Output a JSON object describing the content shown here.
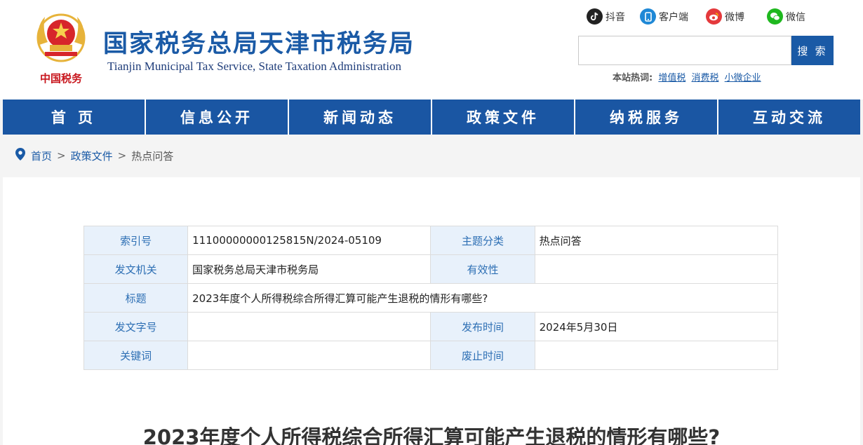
{
  "header": {
    "site_title": "国家税务总局天津市税务局",
    "site_subtitle": "Tianjin Municipal Tax Service, State Taxation Administration",
    "logo_text": "中国税务"
  },
  "social": [
    {
      "label": "抖音",
      "icon": "douyin-icon"
    },
    {
      "label": "客户端",
      "icon": "mobile-client-icon"
    },
    {
      "label": "微博",
      "icon": "weibo-icon"
    },
    {
      "label": "微信",
      "icon": "wechat-icon"
    }
  ],
  "search": {
    "value": "",
    "placeholder": "",
    "button_label": "搜 索",
    "hot_label": "本站热词:",
    "hot_words": [
      "增值税",
      "消费税",
      "小微企业"
    ]
  },
  "nav": [
    "首 页",
    "信息公开",
    "新闻动态",
    "政策文件",
    "纳税服务",
    "互动交流"
  ],
  "breadcrumb": {
    "items": [
      "首页",
      "政策文件",
      "热点问答"
    ],
    "separator": ">"
  },
  "meta": {
    "index_label": "索引号",
    "index_value": "11100000000125815N/2024-05109",
    "topic_label": "主题分类",
    "topic_value": "热点问答",
    "issuer_label": "发文机关",
    "issuer_value": "国家税务总局天津市税务局",
    "validity_label": "有效性",
    "validity_value": "",
    "title_label": "标题",
    "title_value": "2023年度个人所得税综合所得汇算可能产生退税的情形有哪些?",
    "docno_label": "发文字号",
    "docno_value": "",
    "pubdate_label": "发布时间",
    "pubdate_value": "2024年5月30日",
    "keywords_label": "关键词",
    "keywords_value": "",
    "expire_label": "废止时间",
    "expire_value": ""
  },
  "article": {
    "title": "2023年度个人所得税综合所得汇算可能产生退税的情形有哪些?"
  },
  "colors": {
    "brand_blue": "#1a5aa6",
    "nav_blue": "#1a56a3",
    "label_bg": "#e8f1fb",
    "logo_red": "#c8161d",
    "logo_gold": "#e7b33a"
  }
}
